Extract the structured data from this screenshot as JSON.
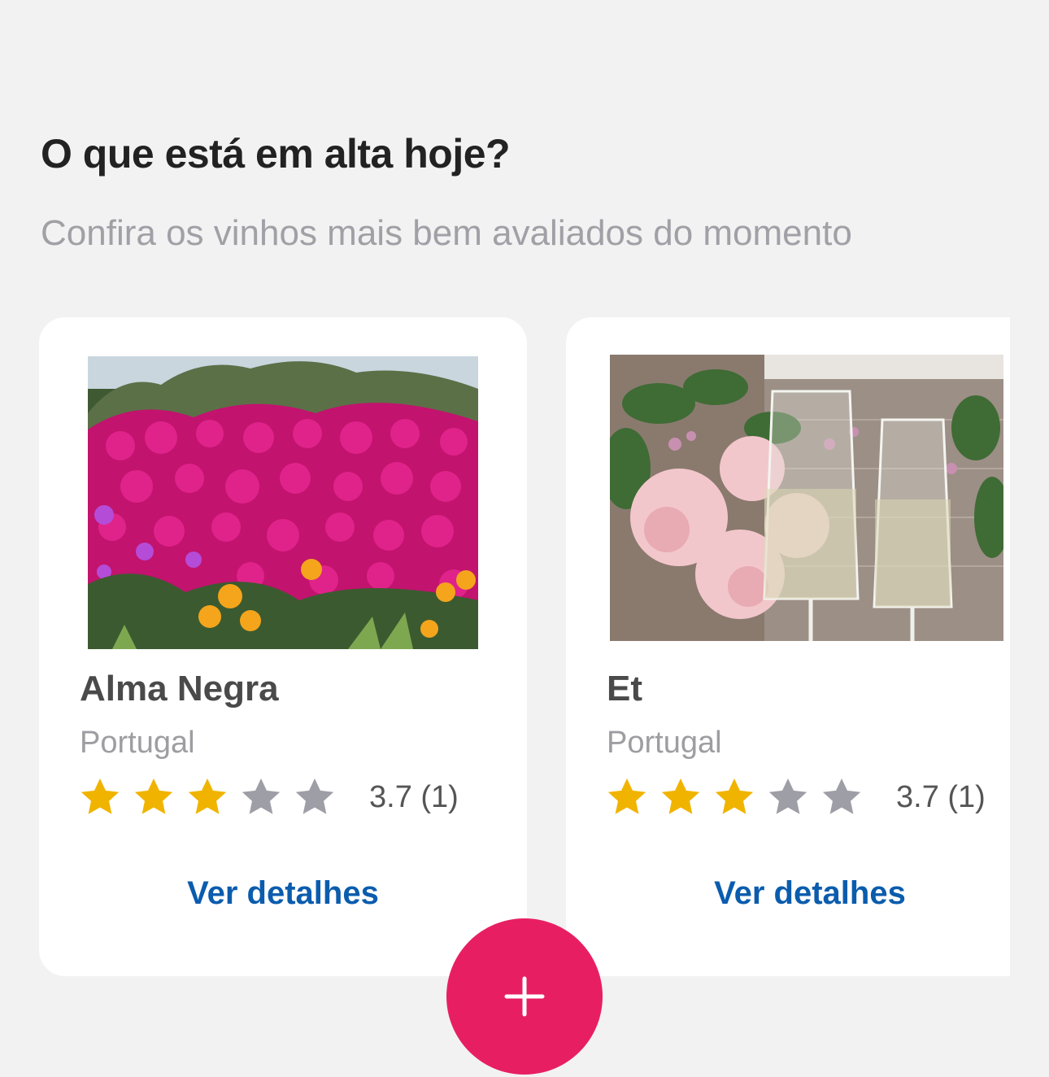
{
  "section": {
    "title": "O que está em alta hoje?",
    "subtitle": "Confira os vinhos mais bem avaliados do momento"
  },
  "wines": [
    {
      "name": "Alma Negra",
      "country": "Portugal",
      "rating": 3.7,
      "rating_text": "3.7 (1)",
      "stars_filled": 3,
      "stars_total": 5,
      "details_label": "Ver detalhes",
      "image": "pink-flowers-photo"
    },
    {
      "name": "Et",
      "country": "Portugal",
      "rating": 3.7,
      "rating_text": "3.7 (1)",
      "stars_filled": 3,
      "stars_total": 5,
      "details_label": "Ver detalhes",
      "image": "champagne-glasses-photo"
    }
  ],
  "fab": {
    "icon": "plus-icon"
  },
  "colors": {
    "background": "#f2f2f2",
    "card": "#ffffff",
    "star_filled": "#f0b400",
    "star_empty": "#9e9ea6",
    "link": "#0b5cad",
    "fab": "#e81e63"
  }
}
